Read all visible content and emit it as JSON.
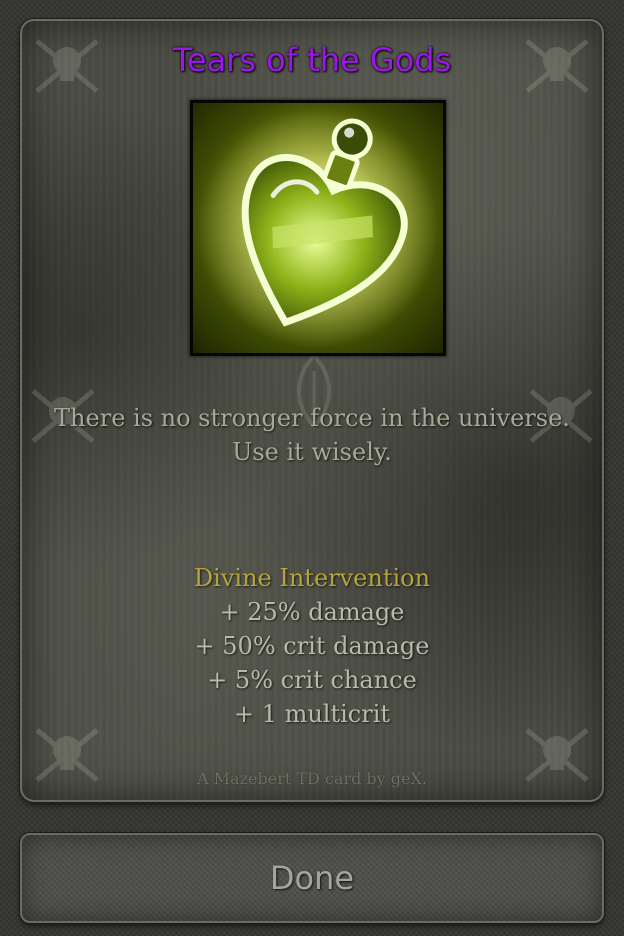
{
  "card": {
    "title": "Tears of the Gods",
    "image_icon": "heart-potion-icon",
    "description_lines": [
      "There is no stronger force in the universe.",
      "Use it wisely."
    ],
    "ability": {
      "name": "Divine Intervention",
      "stats": [
        "+ 25% damage",
        "+ 50% crit damage",
        "+ 5% crit chance",
        "+ 1 multicrit"
      ]
    },
    "credit": "A Mazebert TD card by geX."
  },
  "done_button": {
    "label": "Done"
  },
  "colors": {
    "title": "#9a17e8",
    "ability_name": "#b8a43a",
    "text": "#b9baa8",
    "potion_glow": "#c8d63a"
  }
}
